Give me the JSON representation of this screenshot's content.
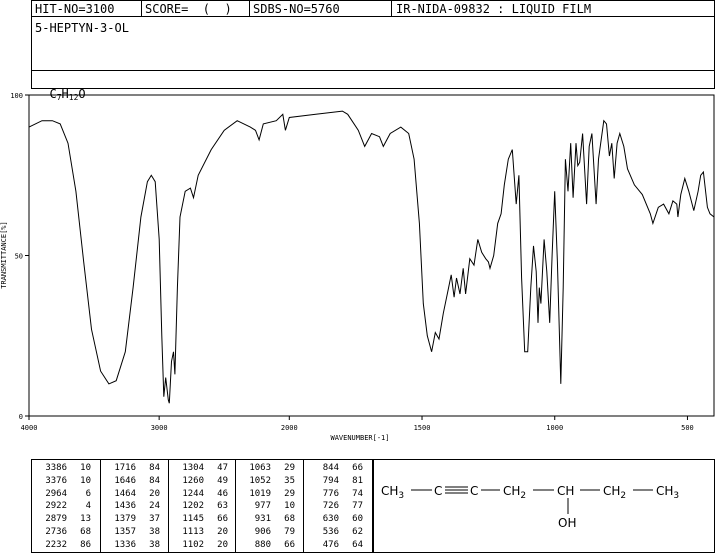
{
  "header": {
    "hit_no": "HIT-NO=3100",
    "score": "SCORE=  (  )",
    "sdbs_no": "SDBS-NO=5760",
    "ir_no": "IR-NIDA-09832 : LIQUID FILM",
    "compound_name": "5-HEPTYN-3-OL",
    "formula_c": "C",
    "formula_c_sub": "7",
    "formula_h": "H",
    "formula_h_sub": "12",
    "formula_o": "O"
  },
  "chart_data": {
    "type": "line",
    "xlabel": "WAVENUMBER[-1]",
    "ylabel": "TRANSMITTANCE[%]",
    "xlim": [
      4000,
      400
    ],
    "ylim": [
      0,
      100
    ],
    "x_tick_labels": [
      "4000",
      "3000",
      "2000",
      "1500",
      "1000",
      "500"
    ],
    "x_tick_values": [
      4000,
      3000,
      2000,
      1500,
      1000,
      500
    ],
    "y_tick_labels": [
      "0",
      "50",
      "100"
    ],
    "y_tick_values": [
      0,
      50,
      100
    ],
    "series": [
      {
        "points": [
          [
            4000,
            90
          ],
          [
            3900,
            92
          ],
          [
            3820,
            92
          ],
          [
            3760,
            91
          ],
          [
            3700,
            85
          ],
          [
            3640,
            70
          ],
          [
            3580,
            48
          ],
          [
            3520,
            27
          ],
          [
            3450,
            14
          ],
          [
            3386,
            10
          ],
          [
            3330,
            11
          ],
          [
            3260,
            20
          ],
          [
            3200,
            40
          ],
          [
            3140,
            62
          ],
          [
            3090,
            73
          ],
          [
            3060,
            75
          ],
          [
            3030,
            73
          ],
          [
            3000,
            55
          ],
          [
            2980,
            25
          ],
          [
            2964,
            6
          ],
          [
            2950,
            12
          ],
          [
            2930,
            5
          ],
          [
            2922,
            4
          ],
          [
            2905,
            17
          ],
          [
            2890,
            20
          ],
          [
            2879,
            13
          ],
          [
            2860,
            40
          ],
          [
            2840,
            62
          ],
          [
            2800,
            70
          ],
          [
            2760,
            71
          ],
          [
            2736,
            68
          ],
          [
            2700,
            75
          ],
          [
            2600,
            83
          ],
          [
            2500,
            89
          ],
          [
            2400,
            92
          ],
          [
            2300,
            90
          ],
          [
            2260,
            89
          ],
          [
            2232,
            86
          ],
          [
            2200,
            91
          ],
          [
            2100,
            92
          ],
          [
            2050,
            94
          ],
          [
            2030,
            89
          ],
          [
            2000,
            93
          ],
          [
            1900,
            94
          ],
          [
            1800,
            95
          ],
          [
            1780,
            94
          ],
          [
            1740,
            89
          ],
          [
            1716,
            84
          ],
          [
            1690,
            88
          ],
          [
            1660,
            87
          ],
          [
            1646,
            84
          ],
          [
            1620,
            88
          ],
          [
            1580,
            90
          ],
          [
            1550,
            88
          ],
          [
            1530,
            80
          ],
          [
            1510,
            60
          ],
          [
            1495,
            35
          ],
          [
            1480,
            25
          ],
          [
            1464,
            20
          ],
          [
            1450,
            26
          ],
          [
            1436,
            24
          ],
          [
            1420,
            32
          ],
          [
            1400,
            40
          ],
          [
            1390,
            44
          ],
          [
            1379,
            37
          ],
          [
            1370,
            43
          ],
          [
            1357,
            38
          ],
          [
            1345,
            46
          ],
          [
            1336,
            38
          ],
          [
            1320,
            49
          ],
          [
            1304,
            47
          ],
          [
            1290,
            55
          ],
          [
            1275,
            51
          ],
          [
            1260,
            49
          ],
          [
            1250,
            48
          ],
          [
            1244,
            46
          ],
          [
            1230,
            50
          ],
          [
            1215,
            60
          ],
          [
            1202,
            63
          ],
          [
            1190,
            72
          ],
          [
            1175,
            80
          ],
          [
            1160,
            83
          ],
          [
            1145,
            66
          ],
          [
            1135,
            75
          ],
          [
            1125,
            43
          ],
          [
            1113,
            20
          ],
          [
            1102,
            20
          ],
          [
            1090,
            40
          ],
          [
            1080,
            53
          ],
          [
            1070,
            45
          ],
          [
            1063,
            29
          ],
          [
            1058,
            40
          ],
          [
            1052,
            35
          ],
          [
            1040,
            55
          ],
          [
            1030,
            45
          ],
          [
            1019,
            29
          ],
          [
            1010,
            50
          ],
          [
            1000,
            70
          ],
          [
            990,
            48
          ],
          [
            977,
            10
          ],
          [
            968,
            40
          ],
          [
            960,
            80
          ],
          [
            950,
            70
          ],
          [
            940,
            85
          ],
          [
            931,
            68
          ],
          [
            920,
            85
          ],
          [
            913,
            78
          ],
          [
            906,
            79
          ],
          [
            895,
            88
          ],
          [
            880,
            66
          ],
          [
            870,
            84
          ],
          [
            860,
            88
          ],
          [
            844,
            66
          ],
          [
            835,
            80
          ],
          [
            815,
            92
          ],
          [
            805,
            91
          ],
          [
            794,
            81
          ],
          [
            785,
            85
          ],
          [
            776,
            74
          ],
          [
            765,
            85
          ],
          [
            755,
            88
          ],
          [
            740,
            84
          ],
          [
            726,
            77
          ],
          [
            700,
            72
          ],
          [
            670,
            69
          ],
          [
            640,
            63
          ],
          [
            630,
            60
          ],
          [
            610,
            65
          ],
          [
            590,
            66
          ],
          [
            570,
            63
          ],
          [
            555,
            67
          ],
          [
            540,
            66
          ],
          [
            536,
            62
          ],
          [
            525,
            69
          ],
          [
            510,
            74
          ],
          [
            495,
            70
          ],
          [
            476,
            64
          ],
          [
            460,
            70
          ],
          [
            450,
            75
          ],
          [
            440,
            76
          ],
          [
            425,
            65
          ],
          [
            415,
            63
          ],
          [
            400,
            62
          ]
        ]
      }
    ]
  },
  "peaks": [
    [
      "3386",
      "10"
    ],
    [
      "3376",
      "10"
    ],
    [
      "2964",
      "6"
    ],
    [
      "2922",
      "4"
    ],
    [
      "2879",
      "13"
    ],
    [
      "2736",
      "68"
    ],
    [
      "2232",
      "86"
    ],
    [
      "1716",
      "84"
    ],
    [
      "1646",
      "84"
    ],
    [
      "1464",
      "20"
    ],
    [
      "1436",
      "24"
    ],
    [
      "1379",
      "37"
    ],
    [
      "1357",
      "38"
    ],
    [
      "1336",
      "38"
    ],
    [
      "1304",
      "47"
    ],
    [
      "1260",
      "49"
    ],
    [
      "1244",
      "46"
    ],
    [
      "1202",
      "63"
    ],
    [
      "1145",
      "66"
    ],
    [
      "1113",
      "20"
    ],
    [
      "1102",
      "20"
    ],
    [
      "1063",
      "29"
    ],
    [
      "1052",
      "35"
    ],
    [
      "1019",
      "29"
    ],
    [
      "977",
      "10"
    ],
    [
      "931",
      "68"
    ],
    [
      "906",
      "79"
    ],
    [
      "880",
      "66"
    ],
    [
      "844",
      "66"
    ],
    [
      "794",
      "81"
    ],
    [
      "776",
      "74"
    ],
    [
      "726",
      "77"
    ],
    [
      "630",
      "60"
    ],
    [
      "536",
      "62"
    ],
    [
      "476",
      "64"
    ]
  ],
  "structure": {
    "ch3_left": "CH",
    "ch3_left_sub": "3",
    "c1": "C",
    "c2": "C",
    "ch2_a": "CH",
    "ch2_a_sub": "2",
    "ch": "CH",
    "ch2_b": "CH",
    "ch2_b_sub": "2",
    "ch3_right": "CH",
    "ch3_right_sub": "3",
    "oh": "OH"
  }
}
